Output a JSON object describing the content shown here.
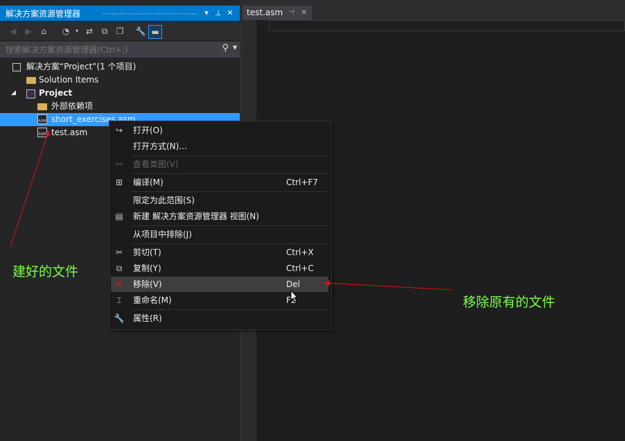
{
  "solution_explorer": {
    "title": "解决方案资源管理器",
    "title_buttons": [
      "▾",
      "⊥",
      "✕"
    ],
    "search_placeholder": "搜索解决方案资源管理器(Ctrl+;)",
    "tree": {
      "solution": "解决方案“Project”(1 个项目)",
      "solution_items": "Solution Items",
      "project": "Project",
      "external_deps": "外部依赖项",
      "file_selected": "short_exercises.asm",
      "file_other": "test.asm"
    },
    "asm_badge": "ASM"
  },
  "editor": {
    "tab_label": "test.asm"
  },
  "context_menu": {
    "items": [
      {
        "label": "打开(O)",
        "shortcut": ""
      },
      {
        "label": "打开方式(N)...",
        "shortcut": ""
      },
      {
        "label": "查看类图(V)",
        "shortcut": ""
      },
      {
        "label": "编译(M)",
        "shortcut": "Ctrl+F7"
      },
      {
        "label": "限定为此范围(S)",
        "shortcut": ""
      },
      {
        "label": "新建 解决方案资源管理器 视图(N)",
        "shortcut": ""
      },
      {
        "label": "从项目中排除(J)",
        "shortcut": ""
      },
      {
        "label": "剪切(T)",
        "shortcut": "Ctrl+X"
      },
      {
        "label": "复制(Y)",
        "shortcut": "Ctrl+C"
      },
      {
        "label": "移除(V)",
        "shortcut": "Del"
      },
      {
        "label": "重命名(M)",
        "shortcut": "F2"
      },
      {
        "label": "属性(R)",
        "shortcut": ""
      }
    ]
  },
  "annotations": {
    "created_file": "建好的文件",
    "remove_original": "移除原有的文件"
  },
  "colors": {
    "accent": "#007acc",
    "selection": "#3399ff",
    "annotation": "#7dff4a",
    "arrow": "#e01010"
  }
}
